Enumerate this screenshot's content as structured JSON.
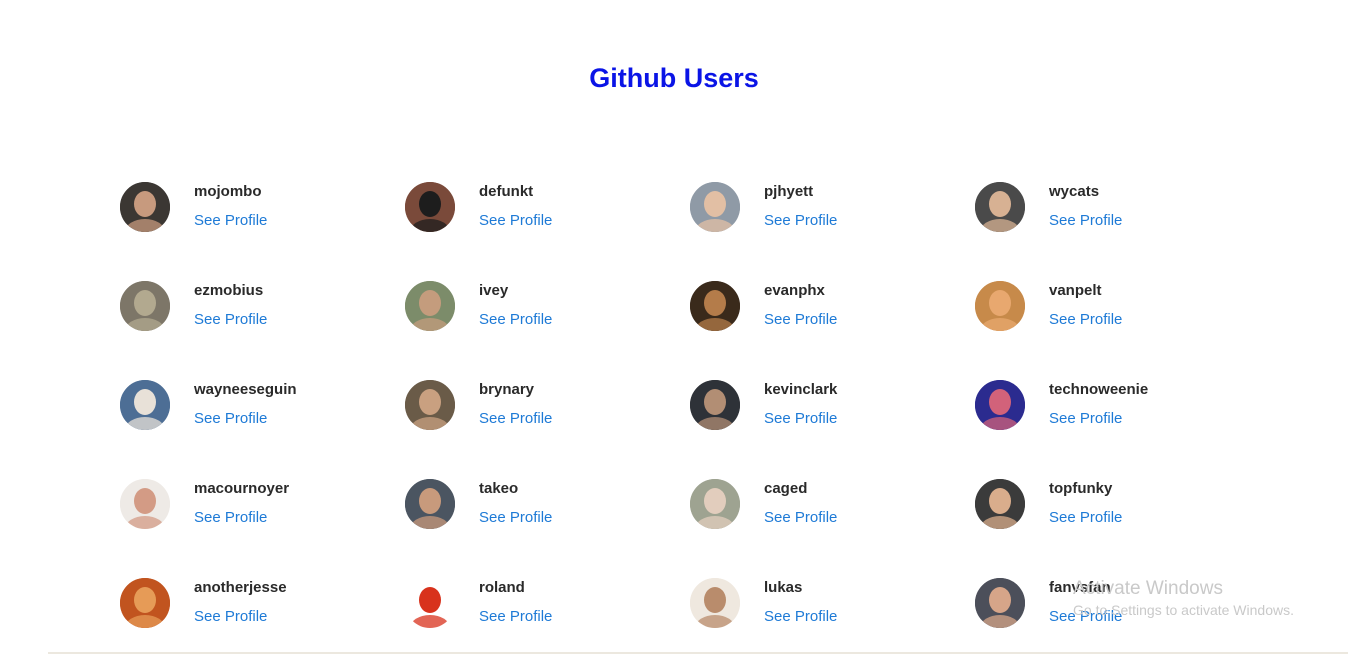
{
  "page": {
    "title": "Github Users",
    "title_color": "#0a14e6",
    "link_color": "#1e7ad6"
  },
  "users": [
    {
      "login": "mojombo",
      "link": "See Profile",
      "avatar_bg": "#3b3733",
      "avatar_fg": "#c79a7e"
    },
    {
      "login": "defunkt",
      "link": "See Profile",
      "avatar_bg": "#7a4a3a",
      "avatar_fg": "#1d1d1d"
    },
    {
      "login": "pjhyett",
      "link": "See Profile",
      "avatar_bg": "#8f9aa6",
      "avatar_fg": "#e2bfa4"
    },
    {
      "login": "wycats",
      "link": "See Profile",
      "avatar_bg": "#4a4a4a",
      "avatar_fg": "#d7b193"
    },
    {
      "login": "ezmobius",
      "link": "See Profile",
      "avatar_bg": "#7d7668",
      "avatar_fg": "#b2a98f"
    },
    {
      "login": "ivey",
      "link": "See Profile",
      "avatar_bg": "#7c8c6a",
      "avatar_fg": "#c49c7d"
    },
    {
      "login": "evanphx",
      "link": "See Profile",
      "avatar_bg": "#3a2a1b",
      "avatar_fg": "#b47c4a"
    },
    {
      "login": "vanpelt",
      "link": "See Profile",
      "avatar_bg": "#c78a4a",
      "avatar_fg": "#e8a86f"
    },
    {
      "login": "wayneeseguin",
      "link": "See Profile",
      "avatar_bg": "#4d6e95",
      "avatar_fg": "#e8e1d8"
    },
    {
      "login": "brynary",
      "link": "See Profile",
      "avatar_bg": "#6a5b48",
      "avatar_fg": "#c9a080"
    },
    {
      "login": "kevinclark",
      "link": "See Profile",
      "avatar_bg": "#2e3238",
      "avatar_fg": "#b28e74"
    },
    {
      "login": "technoweenie",
      "link": "See Profile",
      "avatar_bg": "#2b2b8f",
      "avatar_fg": "#d2627a"
    },
    {
      "login": "macournoyer",
      "link": "See Profile",
      "avatar_bg": "#eeeae6",
      "avatar_fg": "#d39b85"
    },
    {
      "login": "takeo",
      "link": "See Profile",
      "avatar_bg": "#4b5561",
      "avatar_fg": "#c89a7c"
    },
    {
      "login": "caged",
      "link": "See Profile",
      "avatar_bg": "#9ea391",
      "avatar_fg": "#e2cdbd"
    },
    {
      "login": "topfunky",
      "link": "See Profile",
      "avatar_bg": "#3b3b3b",
      "avatar_fg": "#d9ad8c"
    },
    {
      "login": "anotherjesse",
      "link": "See Profile",
      "avatar_bg": "#c1541f",
      "avatar_fg": "#e69b57"
    },
    {
      "login": "roland",
      "link": "See Profile",
      "avatar_bg": "#ffffff",
      "avatar_fg": "#d8321c"
    },
    {
      "login": "lukas",
      "link": "See Profile",
      "avatar_bg": "#efe8df",
      "avatar_fg": "#b98c6c"
    },
    {
      "login": "fanvsfan",
      "link": "See Profile",
      "avatar_bg": "#4c4f5a",
      "avatar_fg": "#d6a589"
    }
  ],
  "watermark": {
    "title": "Activate Windows",
    "subtitle": "Go to Settings to activate Windows."
  }
}
